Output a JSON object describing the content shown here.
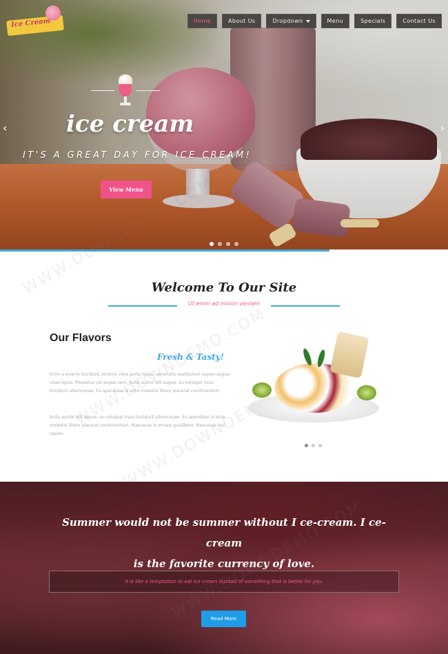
{
  "brand": {
    "logo_text": "Ice Cream"
  },
  "nav": {
    "items": [
      {
        "label": "Home",
        "active": true
      },
      {
        "label": "About Us"
      },
      {
        "label": "Dropdown",
        "has_caret": true
      },
      {
        "label": "Menu"
      },
      {
        "label": "Specials"
      },
      {
        "label": "Contact Us"
      }
    ]
  },
  "hero": {
    "title": "ice cream",
    "subtitle": "IT'S A GREAT DAY FOR ICE CREAM!",
    "button_label": "View Menu",
    "prev_arrow": "‹",
    "next_arrow": "›",
    "slides_total": 4,
    "active_slide": 1,
    "progress_fraction": 0.735
  },
  "welcome": {
    "title": "Welcome To Our Site",
    "subtitle": "Ut enim ad minim veniam"
  },
  "flavors": {
    "title": "Our Flavors",
    "tagline": "Fresh & Tasty!",
    "paragraph1": "Enim a viverra tincidunt, lectoris vinia porta ligula, venenatis vestibulum sapien augue vitae ligula. Phasellus vel augue sem. Nulla auctor elit augue, eu volutpat risus tincidunt ullamcorper. Eu spendisse id ante molestie libero placerat condimentum.",
    "paragraph2": "Nulla auctor elit augue, eu volutpat risus tincidunt ullamcorper. Eu spendisse id ante molestie libero placerat condimentum. Maecenas in ornare quislibero. Maecenas nisl sapien.",
    "carousel_dots": 3,
    "carousel_active": 1
  },
  "quote": {
    "line1": "Summer would not be summer without I ce-cream. I ce-cream",
    "line2": "is the favorite currency of love.",
    "note": "It is like a temptation to eat ice cream instead of something that is better for you.",
    "button_label": "Read More"
  },
  "watermark_text": "WWW.DOWNDEMO.COM",
  "colors": {
    "accent_pink": "#f0528a",
    "accent_blue": "#3fa5e0",
    "nav_bg": "#4a4644",
    "button_blue": "#1e9ce8"
  }
}
